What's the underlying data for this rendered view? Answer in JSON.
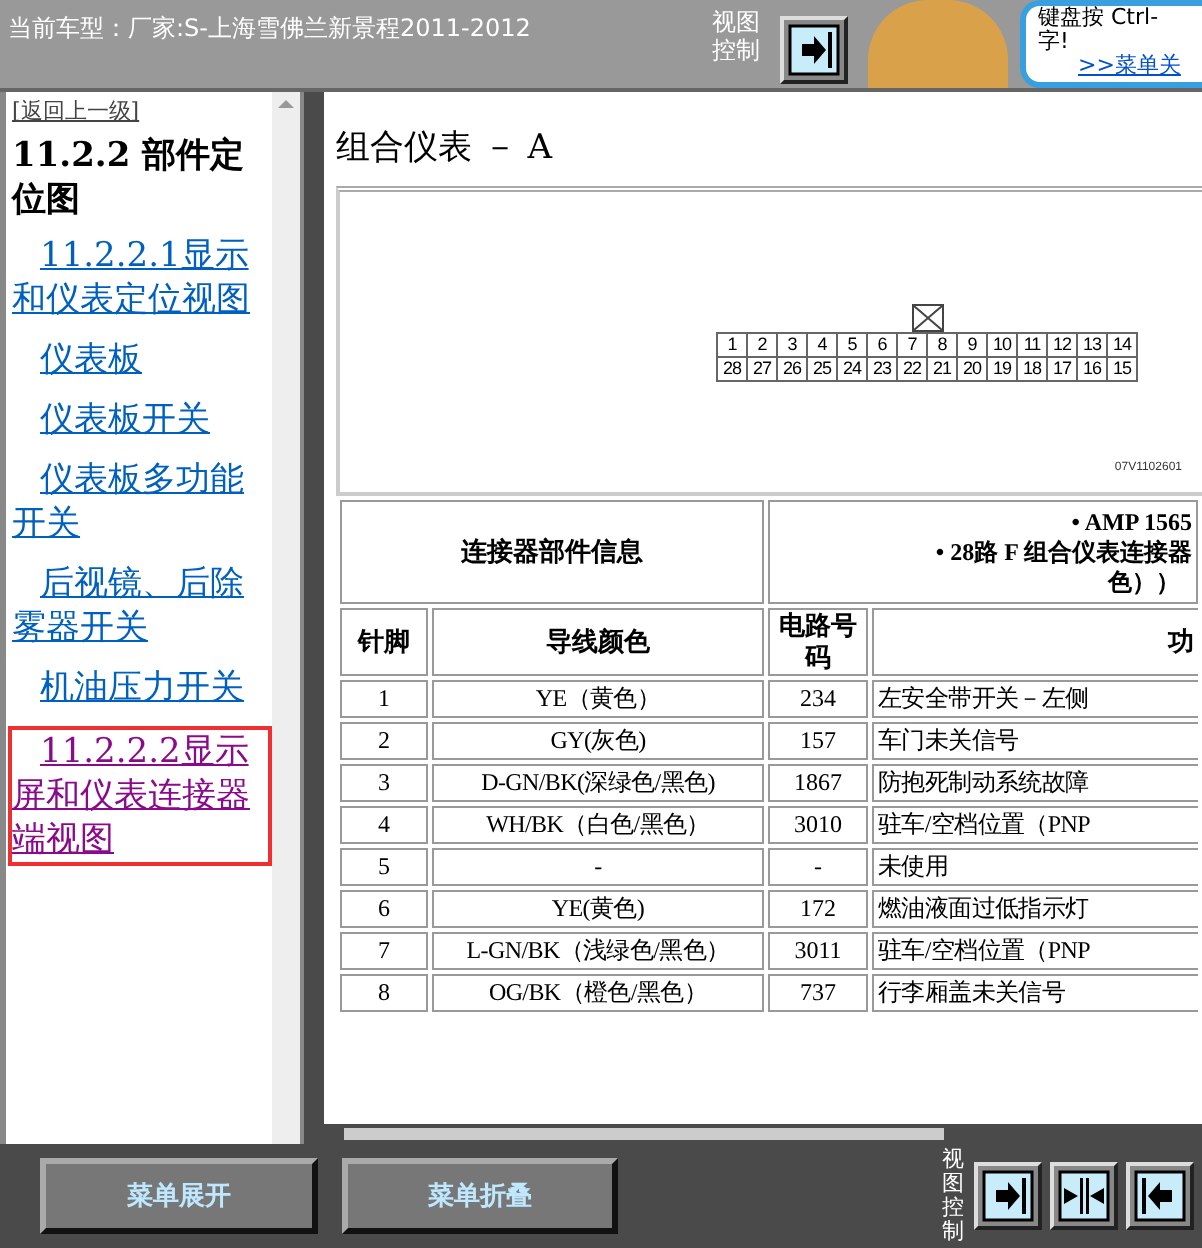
{
  "header": {
    "vehicle": "当前车型：厂家:S-上海雪佛兰新景程2011-2012",
    "view_control_label": "视图控制",
    "tip": {
      "text": "键盘按 Ctrl-",
      "text2": "字!",
      "link": ">>菜单关"
    }
  },
  "sidebar": {
    "back_link": "[返回上一级]",
    "heading": "11.2.2 部件定位图",
    "items": [
      {
        "label": "11.2.2.1显示和仪表定位视图",
        "selected": false
      },
      {
        "label": "仪表板",
        "selected": false
      },
      {
        "label": "仪表板开关",
        "selected": false
      },
      {
        "label": "仪表板多功能开关",
        "selected": false
      },
      {
        "label": "后视镜、后除雾器开关",
        "selected": false
      },
      {
        "label": "机油压力开关",
        "selected": false
      },
      {
        "label": "11.2.2.2显示屏和仪表连接器端视图",
        "selected": true
      }
    ]
  },
  "content": {
    "title": "组合仪表 － A",
    "connector": {
      "top_row": [
        "1",
        "2",
        "3",
        "4",
        "5",
        "6",
        "7",
        "8",
        "9",
        "10",
        "11",
        "12",
        "13",
        "14"
      ],
      "bottom_row": [
        "28",
        "27",
        "26",
        "25",
        "24",
        "23",
        "22",
        "21",
        "20",
        "19",
        "18",
        "17",
        "16",
        "15"
      ],
      "figure_code": "07V1102601"
    },
    "info": {
      "label": "连接器部件信息",
      "lines": [
        "• AMP 1565",
        "• 28路 F 组合仪表连接器"
      ],
      "tail": "色））"
    },
    "table": {
      "columns": [
        "针脚",
        "导线颜色",
        "电路号码",
        "功"
      ],
      "rows": [
        [
          "1",
          "YE（黄色）",
          "234",
          "左安全带开关－左侧"
        ],
        [
          "2",
          "GY(灰色)",
          "157",
          "车门未关信号"
        ],
        [
          "3",
          "D-GN/BK(深绿色/黑色)",
          "1867",
          "防抱死制动系统故障"
        ],
        [
          "4",
          "WH/BK（白色/黑色）",
          "3010",
          "驻车/空档位置（PNP"
        ],
        [
          "5",
          "-",
          "-",
          "未使用"
        ],
        [
          "6",
          "YE(黄色)",
          "172",
          "燃油液面过低指示灯"
        ],
        [
          "7",
          "L-GN/BK（浅绿色/黑色）",
          "3011",
          "驻车/空档位置（PNP"
        ],
        [
          "8",
          "OG/BK（橙色/黑色）",
          "737",
          "行李厢盖未关信号"
        ]
      ]
    }
  },
  "footer": {
    "buttons": [
      "菜单展开",
      "菜单折叠"
    ],
    "view_control_label": "视图控制"
  }
}
